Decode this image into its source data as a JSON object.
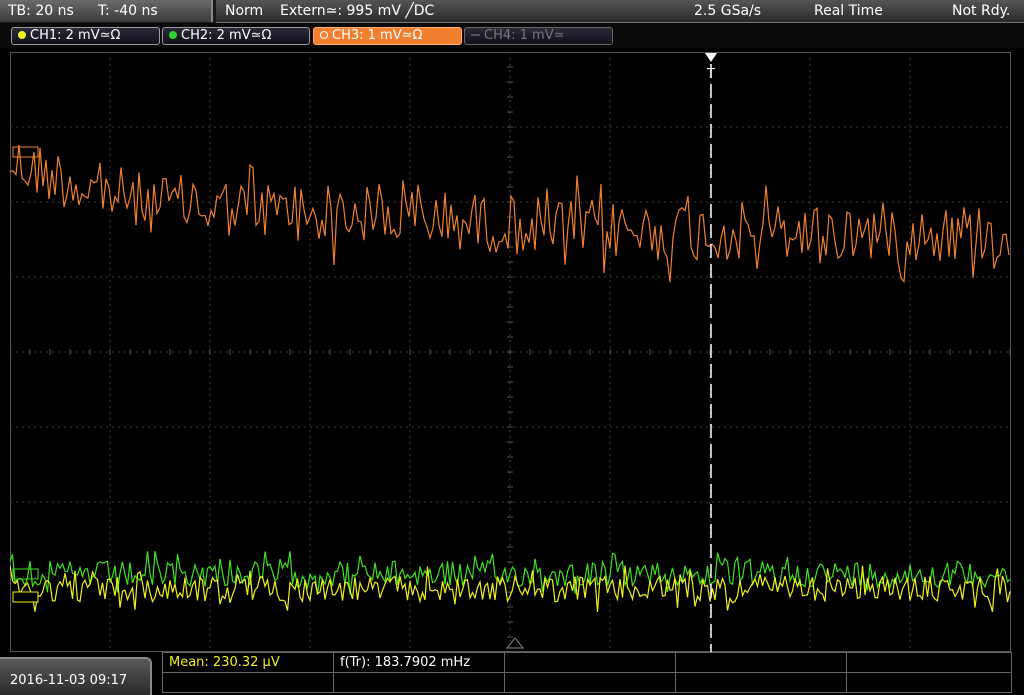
{
  "timebase": {
    "tb": "TB: 20 ns",
    "offset": "T: -40 ns"
  },
  "trigger_info": {
    "mode": "Norm",
    "source": "Extern≃: 995 mV ╱DC",
    "sample_rate": "2.5 GSa/s",
    "acq_mode": "Real Time",
    "status": "Not Rdy."
  },
  "channels": [
    {
      "label": "CH1: 2 mV≃Ω",
      "color": "#f0f020",
      "state": "on"
    },
    {
      "label": "CH2: 2 mV≃Ω",
      "color": "#30d030",
      "state": "on"
    },
    {
      "label": "CH3: 1 mV≃Ω",
      "color": "#f08030",
      "state": "active"
    },
    {
      "label": "CH4: 1 mV≃",
      "color": "#777777",
      "state": "off"
    }
  ],
  "trigger_marker": "T",
  "traces": {
    "ch3": {
      "color": "#f08030"
    },
    "ch2": {
      "color": "#40e020"
    },
    "ch1": {
      "color": "#f0f020"
    }
  },
  "measurements": {
    "mean": "Mean: 230.32 µV",
    "freq": "f(Tr): 183.7902 mHz"
  },
  "datetime": "2016-11-03 09:17"
}
